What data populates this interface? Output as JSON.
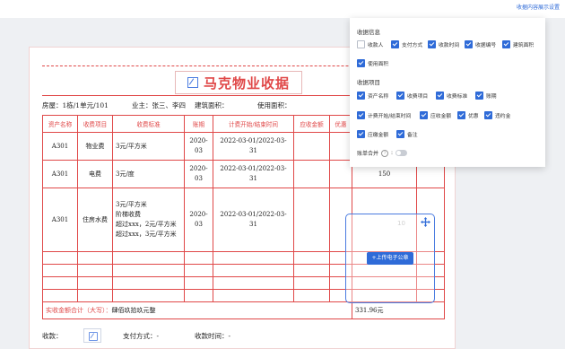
{
  "top_link": "收据内容展示设置",
  "receipt": {
    "title": "马克物业收据",
    "info": {
      "house": "房屋：1栋/1单元/101",
      "owner": "业主：张三、李四",
      "area": "建筑面积：",
      "use_area": "使用面积："
    },
    "headers": [
      "资产名称",
      "收费项目",
      "收费标准",
      "账期",
      "计费开始/结束时间",
      "应收金额",
      "优惠",
      "",
      ""
    ],
    "rows": [
      {
        "asset": "A301",
        "item": "物业费",
        "standard": "3元/平方米",
        "period": "2020-03",
        "time": "2022-03-01/2022-03-31",
        "amount": ""
      },
      {
        "asset": "A301",
        "item": "电费",
        "standard": "3元/度",
        "period": "2020-03",
        "time": "2022-03-01/2022-03-31",
        "amount": "150"
      },
      {
        "asset": "A301",
        "item": "住房水费",
        "standard": "3元/平方米\n阶梯收费\n超过xxx，2元/平方米\n超过xxx，3元/平方米",
        "period": "2020-03",
        "time": "2022-03-01/2022-03-31",
        "amount": ""
      }
    ],
    "sum_label": "实收金额合计（大写）：",
    "sum_words": "肆佰玖拾玖元整",
    "sum_value": "331.96元",
    "footer": {
      "payee": "收款：",
      "pay_method": "支付方式：-",
      "pay_time": "收款时间：-"
    }
  },
  "stamp": {
    "ghost": "10",
    "button": "+上传电子公章"
  },
  "settings_panel": {
    "section1": "收据信息",
    "info_options": [
      {
        "label": "收款人",
        "checked": false
      },
      {
        "label": "支付方式",
        "checked": true
      },
      {
        "label": "收款时间",
        "checked": true
      },
      {
        "label": "收据编号",
        "checked": true
      },
      {
        "label": "建筑面积",
        "checked": true
      },
      {
        "label": "使用面积",
        "checked": true
      }
    ],
    "section2": "收据项目",
    "item_options": [
      {
        "label": "资产名称",
        "checked": true
      },
      {
        "label": "收费项目",
        "checked": true
      },
      {
        "label": "收费标准",
        "checked": true
      },
      {
        "label": "账期",
        "checked": true
      },
      {
        "label": "计费开始/结束时间",
        "checked": true
      },
      {
        "label": "应收金额",
        "checked": true
      },
      {
        "label": "优惠",
        "checked": true
      },
      {
        "label": "违约金",
        "checked": true
      },
      {
        "label": "应缴金额",
        "checked": true
      },
      {
        "label": "备注",
        "checked": true
      }
    ],
    "merge_label": "账单合并",
    "merge_on": false
  }
}
